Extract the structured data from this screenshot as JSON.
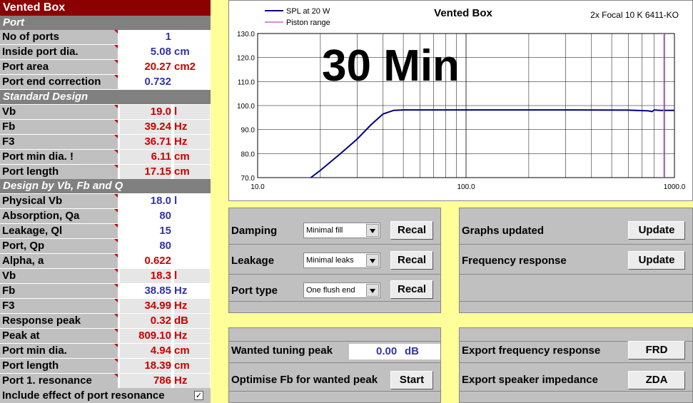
{
  "left": {
    "title": "Vented Box",
    "sections": {
      "port": "Port",
      "standard": "Standard Design",
      "design_by": "Design by Vb, Fb and Q"
    },
    "rows": [
      {
        "label": "No of ports",
        "value": "1",
        "unit": "",
        "color": "blue"
      },
      {
        "label": "Inside port dia.",
        "value": "5.08",
        "unit": "cm",
        "color": "blue"
      },
      {
        "label": "Port area",
        "value": "20.27",
        "unit": "cm2",
        "color": "red"
      },
      {
        "label": "Port end correction",
        "value": "0.732",
        "unit": "",
        "color": "blue"
      },
      {
        "label": "Vb",
        "value": "19.0",
        "unit": "l",
        "color": "red"
      },
      {
        "label": "Fb",
        "value": "39.24",
        "unit": "Hz",
        "color": "red"
      },
      {
        "label": "F3",
        "value": "36.71",
        "unit": "Hz",
        "color": "red"
      },
      {
        "label": "Port min dia. !",
        "value": "6.11",
        "unit": "cm",
        "color": "red"
      },
      {
        "label": "Port length",
        "value": "17.15",
        "unit": "cm",
        "color": "red"
      },
      {
        "label": "Physical Vb",
        "value": "18.0",
        "unit": "l",
        "color": "blue"
      },
      {
        "label": "Absorption, Qa",
        "value": "80",
        "unit": "",
        "color": "blue"
      },
      {
        "label": "Leakage, Ql",
        "value": "15",
        "unit": "",
        "color": "blue"
      },
      {
        "label": "Port, Qp",
        "value": "80",
        "unit": "",
        "color": "blue"
      },
      {
        "label": "Alpha, a",
        "value": "0.622",
        "unit": "",
        "color": "red"
      },
      {
        "label": "Vb",
        "value": "18.3",
        "unit": "l",
        "color": "red"
      },
      {
        "label": "Fb",
        "value": "38.85",
        "unit": "Hz",
        "color": "blue"
      },
      {
        "label": "F3",
        "value": "34.99",
        "unit": "Hz",
        "color": "red"
      },
      {
        "label": "Response peak",
        "value": "0.32",
        "unit": "dB",
        "color": "red"
      },
      {
        "label": "Peak at",
        "value": "809.10",
        "unit": "Hz",
        "color": "red"
      },
      {
        "label": "Port min dia.",
        "value": "4.94",
        "unit": "cm",
        "color": "red"
      },
      {
        "label": "Port length",
        "value": "18.39",
        "unit": "cm",
        "color": "red"
      },
      {
        "label": "Port 1. resonance",
        "value": "786",
        "unit": "Hz",
        "color": "red"
      }
    ],
    "include_label": "Include effect of port resonance",
    "include_checked": "✓"
  },
  "chart": {
    "title": "Vented Box",
    "subtitle": "2x Focal 10 K 6411-KO",
    "overlay": "30 Min",
    "legend": [
      "SPL at 20 W",
      "Piston range"
    ],
    "y_ticks": [
      "130.0",
      "120.0",
      "110.0",
      "100.0",
      "90.0",
      "80.0",
      "70.0"
    ],
    "x_ticks": [
      "10.0",
      "100.0",
      "1000.0"
    ]
  },
  "chart_data": {
    "type": "line",
    "title": "Vented Box",
    "xscale": "log",
    "xlim": [
      10,
      1000
    ],
    "ylim": [
      70,
      130
    ],
    "grid": true,
    "legend_position": "top-left",
    "series": [
      {
        "name": "SPL at 20 W",
        "color": "#000080",
        "x": [
          18,
          20,
          25,
          30,
          35,
          40,
          45,
          50,
          100,
          300,
          600,
          750,
          780,
          800,
          850,
          1000
        ],
        "y": [
          70,
          73,
          80,
          86,
          92,
          96.5,
          98,
          98.2,
          98.2,
          98.2,
          98.1,
          97.8,
          97.5,
          98.2,
          98.0,
          98.0
        ]
      },
      {
        "name": "Piston range",
        "color": "#cc66cc",
        "x": [
          890,
          890
        ],
        "y": [
          70,
          130
        ]
      }
    ]
  },
  "controls": {
    "damping": {
      "label": "Damping",
      "value": "Minimal fill",
      "button": "Recal"
    },
    "leakage": {
      "label": "Leakage",
      "value": "Minimal leaks",
      "button": "Recal"
    },
    "porttype": {
      "label": "Port type",
      "value": "One flush end",
      "button": "Recal"
    },
    "graphs": {
      "label": "Graphs updated",
      "button": "Update"
    },
    "freq": {
      "label": "Frequency response",
      "button": "Update"
    },
    "wanted": {
      "label": "Wanted tuning peak",
      "value": "0.00",
      "unit": "dB"
    },
    "optimise": {
      "label": "Optimise Fb for wanted peak",
      "button": "Start"
    },
    "export_fr": {
      "label": "Export frequency response",
      "button": "FRD"
    },
    "export_imp": {
      "label": "Export speaker impedance",
      "button": "ZDA"
    }
  }
}
